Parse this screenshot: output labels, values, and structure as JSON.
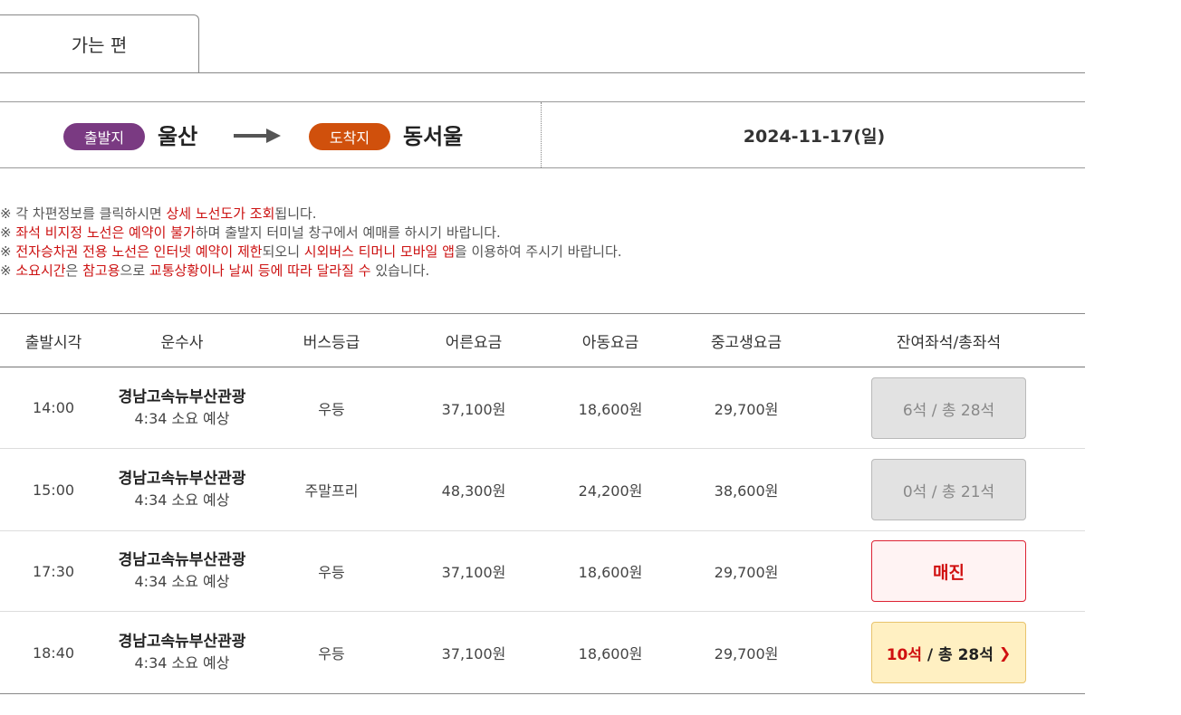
{
  "tab": {
    "label": "가는 편"
  },
  "route": {
    "departure_badge": "출발지",
    "departure_city": "울산",
    "arrival_badge": "도착지",
    "arrival_city": "동서울",
    "date": "2024-11-17(일)",
    "colors": {
      "departure": "#7a3a82",
      "arrival": "#d0500c"
    }
  },
  "notices": [
    [
      {
        "t": "※ 각 차편정보를 클릭하시면 ",
        "red": false
      },
      {
        "t": "상세 노선도가 조회",
        "red": true
      },
      {
        "t": "됩니다.",
        "red": false
      }
    ],
    [
      {
        "t": "※ ",
        "red": false
      },
      {
        "t": "좌석 비지정 노선은 예약이 불가",
        "red": true
      },
      {
        "t": "하며 출발지 터미널 창구에서 예매를 하시기 바랍니다.",
        "red": false
      }
    ],
    [
      {
        "t": "※ ",
        "red": false
      },
      {
        "t": "전자승차권 전용 노선은 인터넷 예약이 제한",
        "red": true
      },
      {
        "t": "되오니 ",
        "red": false
      },
      {
        "t": "시외버스 티머니 모바일 앱",
        "red": true
      },
      {
        "t": "을 이용하여 주시기 바랍니다.",
        "red": false
      }
    ],
    [
      {
        "t": "※ ",
        "red": false
      },
      {
        "t": "소요시간",
        "red": true
      },
      {
        "t": "은 ",
        "red": false
      },
      {
        "t": "참고용",
        "red": true
      },
      {
        "t": "으로 ",
        "red": false
      },
      {
        "t": "교통상황이나 날씨 등에 따라 달라질 수",
        "red": true
      },
      {
        "t": " 있습니다.",
        "red": false
      }
    ]
  ],
  "table": {
    "headers": [
      "출발시각",
      "운수사",
      "버스등급",
      "어른요금",
      "아동요금",
      "중고생요금",
      "잔여좌석/총좌석"
    ],
    "rows": [
      {
        "time": "14:00",
        "company": "경남고속뉴부산관광",
        "duration": "4:34 소요 예상",
        "grade": "우등",
        "adult": "37,100원",
        "child": "18,600원",
        "student": "29,700원",
        "seats": "6석 / 총 28석",
        "status": "gray"
      },
      {
        "time": "15:00",
        "company": "경남고속뉴부산관광",
        "duration": "4:34 소요 예상",
        "grade": "주말프리",
        "adult": "48,300원",
        "child": "24,200원",
        "student": "38,600원",
        "seats": "0석 / 총 21석",
        "status": "gray"
      },
      {
        "time": "17:30",
        "company": "경남고속뉴부산관광",
        "duration": "4:34 소요 예상",
        "grade": "우등",
        "adult": "37,100원",
        "child": "18,600원",
        "student": "29,700원",
        "seats": "매진",
        "status": "sold"
      },
      {
        "time": "18:40",
        "company": "경남고속뉴부산관광",
        "duration": "4:34 소요 예상",
        "grade": "우등",
        "adult": "37,100원",
        "child": "18,600원",
        "student": "29,700원",
        "seats_available": "10석",
        "seats_total": "/ 총 28석",
        "status": "avail",
        "icon": "chevron-right-icon"
      }
    ]
  }
}
